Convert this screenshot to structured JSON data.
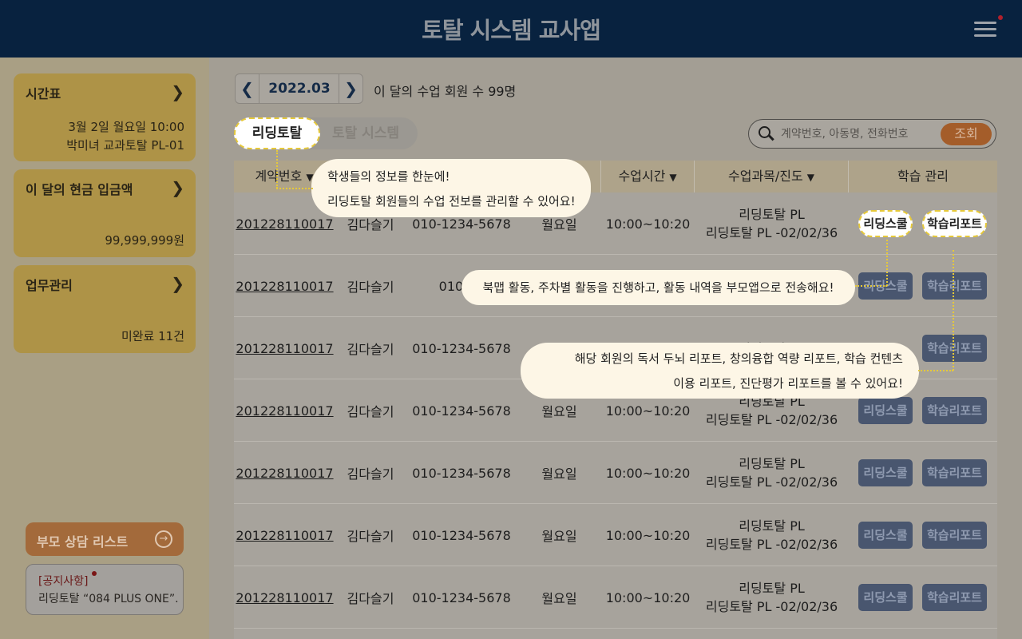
{
  "app": {
    "title": "토탈 시스템 교사앱"
  },
  "sidebar": {
    "schedule": {
      "title": "시간표",
      "line1": "3월 2일 월요일 10:00",
      "line2": "박미녀 교과토탈 PL-01"
    },
    "deposit": {
      "title": "이 달의 현금 입금액",
      "amount": "99,999,999원"
    },
    "tasks": {
      "title": "업무관리",
      "status": "미완료 11건"
    },
    "consult": {
      "label": "부모 상담 리스트"
    },
    "notice": {
      "tag": "[공지사항]",
      "text": "리딩토탈 “084 PLUS ONE”..."
    }
  },
  "month": {
    "label": "2022.03",
    "summary": "이 달의 수업 회원 수 99명"
  },
  "tabs": {
    "reading": "리딩토탈",
    "total": "토탈 시스템"
  },
  "search": {
    "placeholder": "계약번호, 아동명, 전화번호",
    "button": "조회"
  },
  "table": {
    "headers": {
      "contract": "계약번호",
      "time": "수업시간",
      "subject": "수업과목/진도",
      "manage": "학습 관리"
    },
    "rows": [
      {
        "contract": "201228110017",
        "name": "김다슬기",
        "phone": "010-1234-5678",
        "day": "월요일",
        "time": "10:00~10:20",
        "subject1": "리딩토탈 PL",
        "subject2": "리딩토탈 PL -02/02/36",
        "school": "리딩스쿨",
        "report": "학습리포트"
      },
      {
        "contract": "201228110017",
        "name": "김다슬기",
        "phone": "010-12",
        "day": "",
        "time": "",
        "subject1": "",
        "subject2": "",
        "school": "리딩스쿨",
        "report": "학습리포트"
      },
      {
        "contract": "201228110017",
        "name": "김다슬기",
        "phone": "010-1234-5678",
        "day": "",
        "time": "",
        "subject1": "리딩토탈 PL",
        "subject2": "",
        "school": "",
        "report": "학습리포트"
      },
      {
        "contract": "201228110017",
        "name": "김다슬기",
        "phone": "010-1234-5678",
        "day": "월요일",
        "time": "10:00~10:20",
        "subject1": "리딩토탈 PL",
        "subject2": "리딩토탈 PL -02/02/36",
        "school": "리딩스쿨",
        "report": "학습리포트"
      },
      {
        "contract": "201228110017",
        "name": "김다슬기",
        "phone": "010-1234-5678",
        "day": "월요일",
        "time": "10:00~10:20",
        "subject1": "리딩토탈 PL",
        "subject2": "리딩토탈 PL -02/02/36",
        "school": "리딩스쿨",
        "report": "학습리포트"
      },
      {
        "contract": "201228110017",
        "name": "김다슬기",
        "phone": "010-1234-5678",
        "day": "월요일",
        "time": "10:00~10:20",
        "subject1": "리딩토탈 PL",
        "subject2": "리딩토탈 PL -02/02/36",
        "school": "리딩스쿨",
        "report": "학습리포트"
      },
      {
        "contract": "201228110017",
        "name": "김다슬기",
        "phone": "010-1234-5678",
        "day": "월요일",
        "time": "10:00~10:20",
        "subject1": "리딩토탈 PL",
        "subject2": "리딩토탈 PL -02/02/36",
        "school": "리딩스쿨",
        "report": "학습리포트"
      }
    ]
  },
  "tooltips": {
    "t1_line1": "학생들의 정보를 한눈에!",
    "t1_line2": "리딩토탈 회원들의 수업 전보를 관리할 수 있어요!",
    "t2": "북맵 활동, 주차별 활동을 진행하고, 활동 내역을 부모앱으로 전송해요!",
    "t3_line1": "해당 회원의 독서 두뇌 리포트, 창의융합 역량 리포트, 학습 컨텐츠",
    "t3_line2": "이용 리포트, 진단평가 리포트를 볼 수 있어요!"
  },
  "icons": {
    "menu": "hamburger-menu-icon",
    "search": "search-icon",
    "consult": "arrow-circle-right-icon",
    "chevron": "chevron-right-icon"
  },
  "colors": {
    "header": "#08223f",
    "card": "#ae9347",
    "accent": "#a45d2a",
    "button": "#49566f",
    "highlight": "#e6c93a"
  }
}
